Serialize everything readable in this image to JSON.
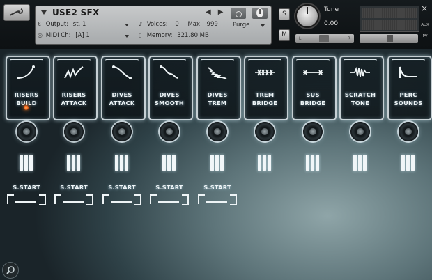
{
  "header": {
    "instrument_name": "USE2 SFX",
    "output_label": "Output:",
    "output_value": "st. 1",
    "midi_label": "MIDI Ch:",
    "midi_value": "[A]  1",
    "voices_label": "Voices:",
    "voices_value": "0",
    "max_label": "Max:",
    "max_value": "999",
    "memory_label": "Memory:",
    "memory_value": "321.80 MB",
    "purge_label": "Purge",
    "solo_label": "S",
    "mute_label": "M",
    "tune_label": "Tune",
    "tune_value": "0.00",
    "pan_left": "L",
    "pan_right": "R",
    "aux_label": "AUX",
    "pv_label": "PV",
    "close_label": "×"
  },
  "articulations": [
    {
      "line1": "RISERS",
      "line2": "BUILD",
      "icon": "riser-curve-icon",
      "active": true
    },
    {
      "line1": "RISERS",
      "line2": "ATTACK",
      "icon": "riser-attack-icon",
      "active": false
    },
    {
      "line1": "DIVES",
      "line2": "ATTACK",
      "icon": "dive-curve-icon",
      "active": false
    },
    {
      "line1": "DIVES",
      "line2": "SMOOTH",
      "icon": "dive-smooth-icon",
      "active": false
    },
    {
      "line1": "DIVES",
      "line2": "TREM",
      "icon": "dive-trem-icon",
      "active": false
    },
    {
      "line1": "TREM",
      "line2": "BRIDGE",
      "icon": "trem-bridge-icon",
      "active": false
    },
    {
      "line1": "SUS",
      "line2": "BRIDGE",
      "icon": "sus-bridge-icon",
      "active": false
    },
    {
      "line1": "SCRATCH",
      "line2": "TONE",
      "icon": "scratch-tone-icon",
      "active": false
    },
    {
      "line1": "PERC",
      "line2": "SOUNDS",
      "icon": "perc-sounds-icon",
      "active": false
    }
  ],
  "sample_start": [
    {
      "label": "S.START"
    },
    {
      "label": "S.START"
    },
    {
      "label": "S.START"
    },
    {
      "label": "S.START"
    },
    {
      "label": "S.START"
    }
  ],
  "colors": {
    "accent_glow": "#e8f3f7",
    "led_active": "#ff7a20",
    "panel_bg": "#1a2429"
  }
}
